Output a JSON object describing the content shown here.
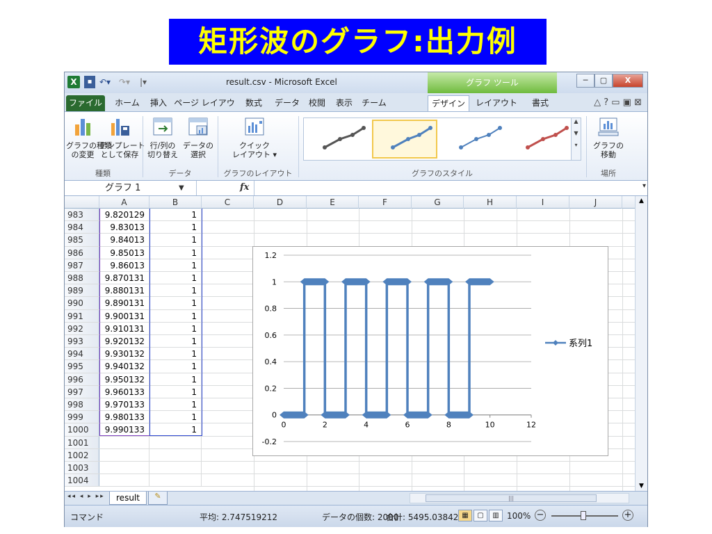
{
  "slide_title": "矩形波のグラフ:出力例",
  "window": {
    "title": "result.csv - Microsoft Excel",
    "chart_tools_label": "グラフ ツール",
    "app_icon": "X",
    "qat_more": "|▾",
    "controls": {
      "minimize": "─",
      "restore": "▢",
      "close": "X"
    }
  },
  "ribbon_tabs": [
    "ファイル",
    "ホーム",
    "挿入",
    "ページ レイアウト",
    "数式",
    "データ",
    "校閲",
    "表示",
    "チーム",
    "デザイン",
    "レイアウト",
    "書式"
  ],
  "ribbon_right_icons": "△ ? ▭ ▣ ⊠",
  "ribbon": {
    "change_type_label": "グラフの種類\nの変更",
    "save_template_label": "テンプレート\nとして保存",
    "group_type": "種類",
    "switch_rowcol_label": "行/列の\n切り替え",
    "select_data_label": "データの\n選択",
    "group_data": "データ",
    "quick_layout_label": "クイック\nレイアウト ▾",
    "group_layout": "グラフのレイアウト",
    "group_styles": "グラフのスタイル",
    "move_chart_label": "グラフの\n移動",
    "group_location": "場所",
    "styles": [
      {
        "color": "#555555"
      },
      {
        "color": "#4f81bd",
        "selected": true
      },
      {
        "color": "#4f81bd"
      },
      {
        "color": "#c0504d"
      }
    ]
  },
  "formula_bar": {
    "name_box": "グラフ 1",
    "fx": "fx",
    "content": ""
  },
  "columns": [
    "A",
    "B",
    "C",
    "D",
    "E",
    "F",
    "G",
    "H",
    "I",
    "J"
  ],
  "rows": [
    {
      "num": "983",
      "a": "9.820129",
      "b": "1"
    },
    {
      "num": "984",
      "a": "9.83013",
      "b": "1"
    },
    {
      "num": "985",
      "a": "9.84013",
      "b": "1"
    },
    {
      "num": "986",
      "a": "9.85013",
      "b": "1"
    },
    {
      "num": "987",
      "a": "9.86013",
      "b": "1"
    },
    {
      "num": "988",
      "a": "9.870131",
      "b": "1"
    },
    {
      "num": "989",
      "a": "9.880131",
      "b": "1"
    },
    {
      "num": "990",
      "a": "9.890131",
      "b": "1"
    },
    {
      "num": "991",
      "a": "9.900131",
      "b": "1"
    },
    {
      "num": "992",
      "a": "9.910131",
      "b": "1"
    },
    {
      "num": "993",
      "a": "9.920132",
      "b": "1"
    },
    {
      "num": "994",
      "a": "9.930132",
      "b": "1"
    },
    {
      "num": "995",
      "a": "9.940132",
      "b": "1"
    },
    {
      "num": "996",
      "a": "9.950132",
      "b": "1"
    },
    {
      "num": "997",
      "a": "9.960133",
      "b": "1"
    },
    {
      "num": "998",
      "a": "9.970133",
      "b": "1"
    },
    {
      "num": "999",
      "a": "9.980133",
      "b": "1"
    },
    {
      "num": "1000",
      "a": "9.990133",
      "b": "1"
    },
    {
      "num": "1001",
      "a": "",
      "b": ""
    },
    {
      "num": "1002",
      "a": "",
      "b": ""
    },
    {
      "num": "1003",
      "a": "",
      "b": ""
    },
    {
      "num": "1004",
      "a": "",
      "b": ""
    }
  ],
  "sheet_tab": "result",
  "sheet_nav": "◂◂ ◂ ▸ ▸▸",
  "status": {
    "mode": "コマンド",
    "average": "平均: 2.747519212",
    "count": "データの個数: 2000",
    "sum": "合計: 5495.038424",
    "zoom": "100%"
  },
  "colors": {
    "series": "#4f81bd",
    "title_bg": "#0000ff",
    "title_fg": "#ffff00"
  },
  "chart_data": {
    "type": "line",
    "series": [
      {
        "name": "系列1",
        "x": [
          0,
          1,
          1,
          2,
          2,
          3,
          3,
          4,
          4,
          5,
          5,
          6,
          6,
          7,
          7,
          8,
          8,
          9,
          9,
          10
        ],
        "y": [
          0,
          0,
          1,
          1,
          0,
          0,
          1,
          1,
          0,
          0,
          1,
          1,
          0,
          0,
          1,
          1,
          0,
          0,
          1,
          1
        ]
      }
    ],
    "x_ticks": [
      0,
      2,
      4,
      6,
      8,
      10,
      12
    ],
    "y_ticks": [
      -0.2,
      0,
      0.2,
      0.4,
      0.6,
      0.8,
      1,
      1.2
    ],
    "xlim": [
      0,
      12
    ],
    "ylim": [
      -0.2,
      1.2
    ],
    "grid": true,
    "legend": "right",
    "title": "",
    "xlabel": "",
    "ylabel": ""
  }
}
